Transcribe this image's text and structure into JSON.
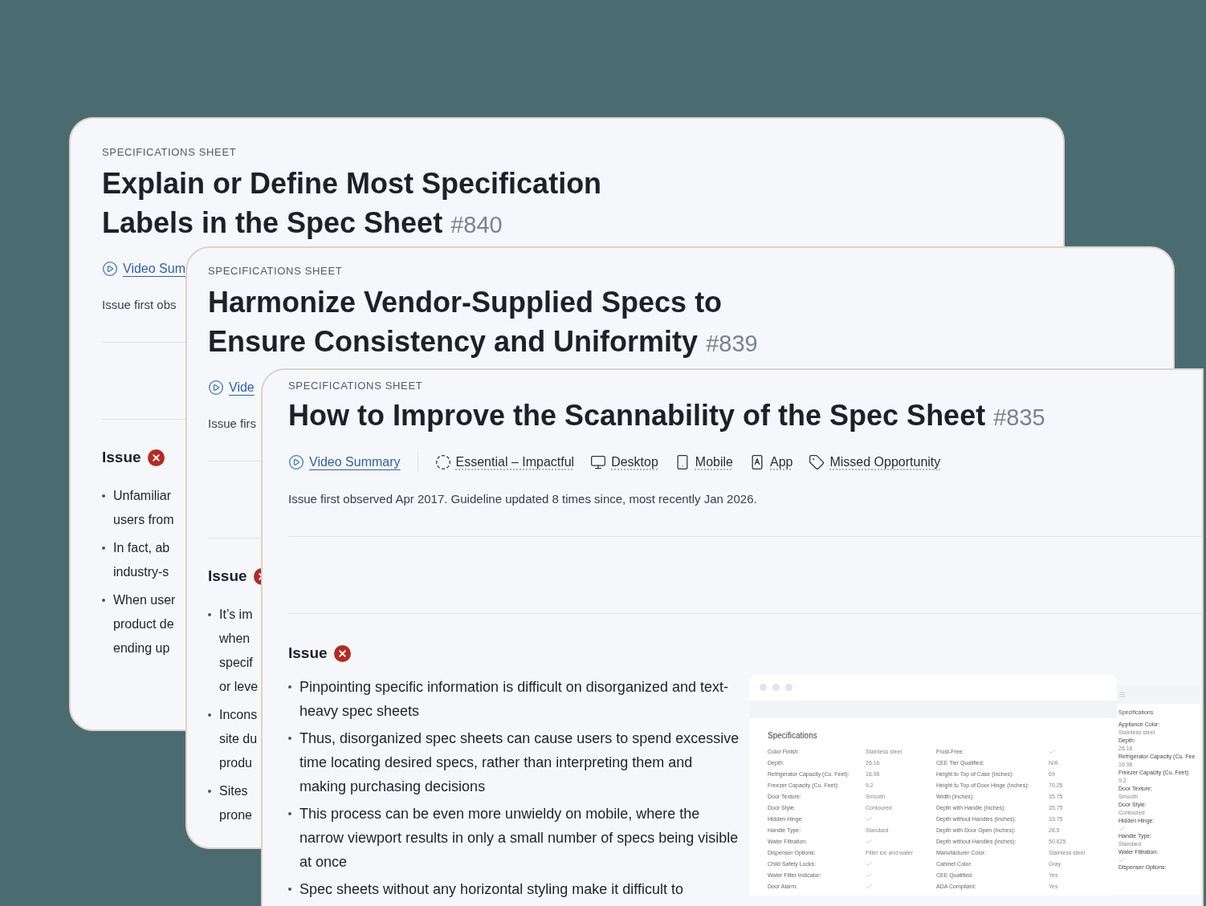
{
  "cards": [
    {
      "eyebrow": "SPECIFICATIONS SHEET",
      "title": "Explain or Define Most Specification Labels in the Spec Sheet",
      "number": "#840",
      "video": "Video Sum",
      "observed": "Issue first obs",
      "issue_heading": "Issue",
      "bullets": [
        [
          "Unfamiliar",
          "users from"
        ],
        [
          "In fact, ab",
          "industry-s"
        ],
        [
          "When user",
          "product de",
          "ending up"
        ]
      ]
    },
    {
      "eyebrow": "SPECIFICATIONS SHEET",
      "title": "Harmonize Vendor-Supplied Specs to Ensure Consistency and Uniformity",
      "number": "#839",
      "video": "Vide",
      "observed": "Issue firs",
      "issue_heading": "Issue",
      "bullets": [
        [
          "It’s im",
          "when",
          "specif",
          "or leve"
        ],
        [
          "Incons",
          "site du",
          "produ"
        ],
        [
          "Sites",
          "prone"
        ]
      ]
    }
  ],
  "front": {
    "eyebrow": "SPECIFICATIONS SHEET",
    "title": "How to Improve the Scannability of the Spec Sheet",
    "number": "#835",
    "meta": [
      {
        "kind": "video",
        "label": "Video Summary"
      },
      {
        "kind": "impact",
        "label": "Essential – Impactful"
      },
      {
        "kind": "desktop",
        "label": "Desktop"
      },
      {
        "kind": "mobile",
        "label": "Mobile"
      },
      {
        "kind": "app",
        "label": "App"
      },
      {
        "kind": "tag",
        "label": "Missed Opportunity"
      }
    ],
    "observed": "Issue first observed Apr 2017. Guideline updated 8 times since, most recently Jan 2026.",
    "issue_heading": "Issue",
    "bullets": [
      "Pinpointing specific information is difficult on disorganized and text-heavy spec sheets",
      "Thus, disorganized spec sheets can cause users to spend excessive time locating desired specs, rather than interpreting them and making purchasing decisions",
      "This process can be even more unwieldy on mobile, where the narrow viewport results in only a small number of specs being visible at once",
      "Spec sheets without any horizontal styling make it difficult to"
    ],
    "desktop_shot": {
      "heading": "Specifications",
      "rows": [
        {
          "label": "Color Finish:",
          "value": "Stainless steel",
          "label2": "Frost-Free:",
          "check2": true
        },
        {
          "label": "Depth:",
          "value": "26.16",
          "label2": "CEE Tier Qualified:",
          "value2": "N/A"
        },
        {
          "label": "Refrigerator Capacity (Cu. Feet):",
          "value": "16.96",
          "label2": "Height to Top of Case (Inches):",
          "value2": "69"
        },
        {
          "label": "Freezer Capacity (Cu. Feet):",
          "value": "9.2",
          "label2": "Height to Top of Door Hinge (Inches):",
          "value2": "70.25"
        },
        {
          "label": "Door Texture:",
          "value": "Smooth",
          "label2": "Width (Inches):",
          "value2": "35.75"
        },
        {
          "label": "Door Style:",
          "value": "Contoured",
          "label2": "Depth with Handle (Inches):",
          "value2": "35.75"
        },
        {
          "label": "Hidden Hinge:",
          "check": true,
          "label2": "Depth without Handles (Inches):",
          "value2": "33.75"
        },
        {
          "label": "Handle Type:",
          "value": "Standard",
          "label2": "Depth with Door Open (Inches):",
          "value2": "28.5"
        },
        {
          "label": "Water Filtration:",
          "check": true,
          "label2": "Depth without Handles (Inches):",
          "value2": "50.625"
        },
        {
          "label": "Dispenser Options:",
          "value": "Filter ice and water",
          "label2": "Manufacturer Color:",
          "value2": "Stainless steel"
        },
        {
          "label": "Child Safety Locks:",
          "check": true,
          "label2": "Cabinet Color:",
          "value2": "Gray"
        },
        {
          "label": "Water Filter Indicator:",
          "check": true,
          "label2": "CEE Qualified:",
          "value2": "Yes"
        },
        {
          "label": "Door Alarm:",
          "check": true,
          "label2": "ADA Compliant:",
          "value2": "Yes"
        }
      ]
    },
    "mobile_shot": {
      "heading": "Specifications",
      "items": [
        {
          "label": "Appliance Color:",
          "value": "Stainless steel"
        },
        {
          "label": "Depth:",
          "value": "26.16"
        },
        {
          "label": "Refrigerator Capacity (Cu. Fee",
          "value": "16.96"
        },
        {
          "label": "Freezer Capacity (Cu. Feet):",
          "value": "9.2"
        },
        {
          "label": "Door Texture:",
          "value": "Smooth"
        },
        {
          "label": "Door Style:",
          "value": "Contoured"
        },
        {
          "label": "Hidden Hinge:",
          "check": true
        },
        {
          "label": "Handle Type:",
          "value": "Standard"
        },
        {
          "label": "Water Filtration:",
          "check": true
        },
        {
          "label": "Dispenser Options:"
        }
      ]
    }
  }
}
